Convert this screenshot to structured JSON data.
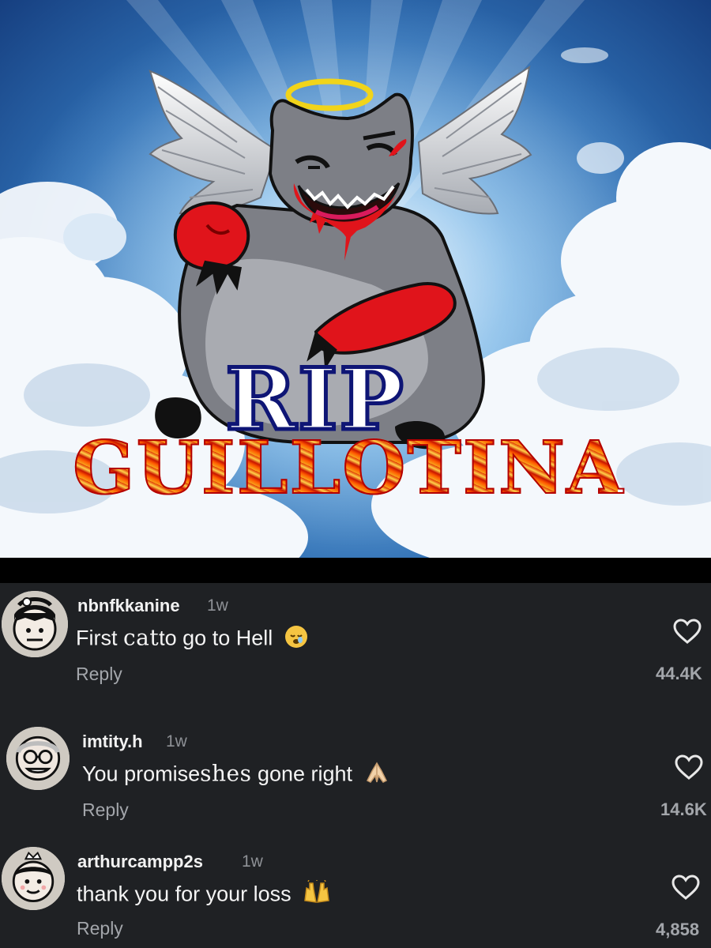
{
  "meme": {
    "title_top": "RIP",
    "title_bottom": "GUILLOTINA"
  },
  "comments": [
    {
      "username": "nbnfkkanine",
      "time": "1w",
      "text_before": "First ",
      "text_handwritten": "cat",
      "text_after": "to go to Hell",
      "emoji": "sleeping-face-emoji",
      "reply_label": "Reply",
      "likes": "44.4K"
    },
    {
      "username": "imtity.h",
      "time": "1w",
      "text_before": "You promise",
      "text_handwritten": "shes",
      "text_after": " gone right",
      "emoji": "folded-hands-emoji",
      "reply_label": "Reply",
      "likes": "14.6K"
    },
    {
      "username": "arthurcampp2s",
      "time": "1w",
      "text_before": "thank you for your loss",
      "text_handwritten": "",
      "text_after": "",
      "emoji": "raising-hands-emoji",
      "reply_label": "Reply",
      "likes": "4,858"
    }
  ],
  "colors": {
    "panel_bg": "#1f2124",
    "username": "#f2f2f2",
    "muted": "#a3a6ab",
    "sky_dark": "#163f80",
    "cat_gray": "#7d7f86",
    "blood_red": "#e0141b",
    "halo": "#f1d41a",
    "rip_outline": "#0e1575"
  }
}
